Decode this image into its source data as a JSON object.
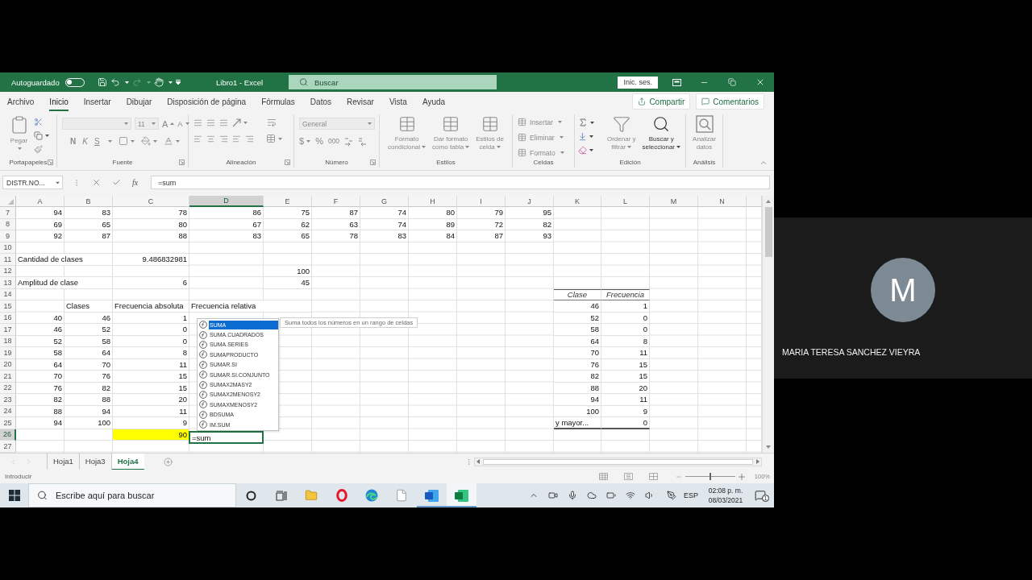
{
  "meeting": {
    "initial": "M",
    "name": "MARIA TERESA SANCHEZ VIEYRA"
  },
  "window": {
    "autosave_label": "Autoguardado",
    "autosave_on": false,
    "title": "Libro1 - Excel",
    "search_placeholder": "Buscar",
    "sign_in": "Inic. ses."
  },
  "ribbon_tabs": [
    {
      "label": "Archivo",
      "selected": false
    },
    {
      "label": "Inicio",
      "selected": true
    },
    {
      "label": "Insertar",
      "selected": false
    },
    {
      "label": "Dibujar",
      "selected": false
    },
    {
      "label": "Disposición de página",
      "selected": false
    },
    {
      "label": "Fórmulas",
      "selected": false
    },
    {
      "label": "Datos",
      "selected": false
    },
    {
      "label": "Revisar",
      "selected": false
    },
    {
      "label": "Vista",
      "selected": false
    },
    {
      "label": "Ayuda",
      "selected": false
    }
  ],
  "ribbon_actions": [
    "Compartir",
    "Comentarios"
  ],
  "ribbon": {
    "groups": [
      {
        "kind": "clipboard",
        "label": "Portapapeles",
        "launcher": true,
        "paste": "Pegar",
        "disabled": true
      },
      {
        "kind": "font",
        "label": "Fuente",
        "launcher": true,
        "size": "11",
        "size_buttons": [
          "A",
          "A"
        ],
        "styles": [
          "N",
          "K",
          "S"
        ],
        "disabled": true
      },
      {
        "kind": "alignment",
        "label": "Alineación",
        "launcher": true,
        "disabled": true
      },
      {
        "kind": "number",
        "label": "Número",
        "launcher": true,
        "format": "General",
        "symbols": [
          "$",
          "%",
          "000"
        ],
        "disabled": true
      },
      {
        "kind": "styles",
        "label": "Estilos",
        "launcher": false,
        "buttons": [
          {
            "lines": [
              "Formato",
              "condicional"
            ],
            "menu": true,
            "disabled": true
          },
          {
            "lines": [
              "Dar formato",
              "como tabla"
            ],
            "menu": true,
            "disabled": true
          },
          {
            "lines": [
              "Estilos de",
              "celda"
            ],
            "menu": true,
            "disabled": true
          }
        ]
      },
      {
        "kind": "cells",
        "label": "Celdas",
        "launcher": false,
        "buttons": [
          {
            "label": "Insertar",
            "disabled": true
          },
          {
            "label": "Eliminar",
            "disabled": true
          },
          {
            "label": "Formato",
            "disabled": true
          }
        ]
      },
      {
        "kind": "editing",
        "label": "Edición",
        "launcher": false,
        "buttons": [
          {
            "lines": [
              "Ordenar y",
              "filtrar"
            ],
            "menu": true,
            "disabled": true
          },
          {
            "lines": [
              "Buscar y",
              "seleccionar"
            ],
            "menu": true,
            "disabled": false
          }
        ]
      },
      {
        "kind": "analysis",
        "label": "Análisis",
        "launcher": false,
        "buttons": [
          {
            "lines": [
              "Analizar",
              "datos"
            ],
            "menu": false,
            "disabled": true
          }
        ]
      }
    ]
  },
  "formula_bar": {
    "name_box": "DISTR.NO...",
    "insert_function": "fx",
    "formula": "=sum"
  },
  "sheet": {
    "columns": [
      {
        "label": "A",
        "selected": false
      },
      {
        "label": "B",
        "selected": false
      },
      {
        "label": "C",
        "selected": false
      },
      {
        "label": "D",
        "selected": true
      },
      {
        "label": "E",
        "selected": false
      },
      {
        "label": "F",
        "selected": false
      },
      {
        "label": "G",
        "selected": false
      },
      {
        "label": "H",
        "selected": false
      },
      {
        "label": "I",
        "selected": false
      },
      {
        "label": "J",
        "selected": false
      },
      {
        "label": "K",
        "selected": false
      },
      {
        "label": "L",
        "selected": false
      },
      {
        "label": "M",
        "selected": false
      },
      {
        "label": "N",
        "selected": false
      }
    ],
    "rows": [
      {
        "number": "7",
        "selected": false,
        "cells": [
          {
            "kind": "number",
            "value": "94"
          },
          {
            "kind": "number",
            "value": "83"
          },
          {
            "kind": "number",
            "value": "78"
          },
          {
            "kind": "number",
            "value": "86"
          },
          {
            "kind": "number",
            "value": "75"
          },
          {
            "kind": "number",
            "value": "87"
          },
          {
            "kind": "number",
            "value": "74"
          },
          {
            "kind": "number",
            "value": "80"
          },
          {
            "kind": "number",
            "value": "79"
          },
          {
            "kind": "number",
            "value": "95"
          }
        ]
      },
      {
        "number": "8",
        "selected": false,
        "cells": [
          {
            "kind": "number",
            "value": "69"
          },
          {
            "kind": "number",
            "value": "65"
          },
          {
            "kind": "number",
            "value": "80"
          },
          {
            "kind": "number",
            "value": "67"
          },
          {
            "kind": "number",
            "value": "62"
          },
          {
            "kind": "number",
            "value": "63"
          },
          {
            "kind": "number",
            "value": "74"
          },
          {
            "kind": "number",
            "value": "89"
          },
          {
            "kind": "number",
            "value": "72"
          },
          {
            "kind": "number",
            "value": "82"
          }
        ]
      },
      {
        "number": "9",
        "selected": false,
        "cells": [
          {
            "kind": "number",
            "value": "92"
          },
          {
            "kind": "number",
            "value": "87"
          },
          {
            "kind": "number",
            "value": "88"
          },
          {
            "kind": "number",
            "value": "83"
          },
          {
            "kind": "number",
            "value": "65"
          },
          {
            "kind": "number",
            "value": "78"
          },
          {
            "kind": "number",
            "value": "83"
          },
          {
            "kind": "number",
            "value": "84"
          },
          {
            "kind": "number",
            "value": "87"
          },
          {
            "kind": "number",
            "value": "93"
          }
        ]
      },
      {
        "number": "10",
        "selected": false
      },
      {
        "number": "11",
        "selected": false,
        "cells": [
          {
            "kind": "label",
            "value": "Cantidad de clases"
          },
          null,
          {
            "kind": "number",
            "value": "9.486832981"
          }
        ]
      },
      {
        "number": "12",
        "selected": false,
        "cells": [
          null,
          null,
          null,
          null,
          {
            "kind": "number",
            "value": "100"
          }
        ]
      },
      {
        "number": "13",
        "selected": false,
        "cells": [
          {
            "kind": "label",
            "value": "Amplitud de clase"
          },
          null,
          {
            "kind": "number",
            "value": "6"
          },
          null,
          {
            "kind": "number",
            "value": "45"
          }
        ]
      },
      {
        "number": "14",
        "selected": false
      },
      {
        "number": "15",
        "selected": false,
        "cells": [
          null,
          {
            "kind": "label",
            "value": "Clases"
          },
          {
            "kind": "label",
            "value": "Frecuencia absoluta"
          },
          {
            "kind": "label",
            "value": "Frecuencia relativa"
          }
        ]
      },
      {
        "number": "16",
        "selected": false,
        "cells": [
          {
            "kind": "number",
            "value": "40"
          },
          {
            "kind": "number",
            "value": "46"
          },
          {
            "kind": "number",
            "value": "1"
          }
        ]
      },
      {
        "number": "17",
        "selected": false,
        "cells": [
          {
            "kind": "number",
            "value": "46"
          },
          {
            "kind": "number",
            "value": "52"
          },
          {
            "kind": "number",
            "value": "0"
          }
        ]
      },
      {
        "number": "18",
        "selected": false,
        "cells": [
          {
            "kind": "number",
            "value": "52"
          },
          {
            "kind": "number",
            "value": "58"
          },
          {
            "kind": "number",
            "value": "0"
          }
        ]
      },
      {
        "number": "19",
        "selected": false,
        "cells": [
          {
            "kind": "number",
            "value": "58"
          },
          {
            "kind": "number",
            "value": "64"
          },
          {
            "kind": "number",
            "value": "8"
          }
        ]
      },
      {
        "number": "20",
        "selected": false,
        "cells": [
          {
            "kind": "number",
            "value": "64"
          },
          {
            "kind": "number",
            "value": "70"
          },
          {
            "kind": "number",
            "value": "11"
          }
        ]
      },
      {
        "number": "21",
        "selected": false,
        "cells": [
          {
            "kind": "number",
            "value": "70"
          },
          {
            "kind": "number",
            "value": "76"
          },
          {
            "kind": "number",
            "value": "15"
          }
        ]
      },
      {
        "number": "22",
        "selected": false,
        "cells": [
          {
            "kind": "number",
            "value": "76"
          },
          {
            "kind": "number",
            "value": "82"
          },
          {
            "kind": "number",
            "value": "15"
          }
        ]
      },
      {
        "number": "23",
        "selected": false,
        "cells": [
          {
            "kind": "number",
            "value": "82"
          },
          {
            "kind": "number",
            "value": "88"
          },
          {
            "kind": "number",
            "value": "20"
          }
        ]
      },
      {
        "number": "24",
        "selected": false,
        "cells": [
          {
            "kind": "number",
            "value": "88"
          },
          {
            "kind": "number",
            "value": "94"
          },
          {
            "kind": "number",
            "value": "11"
          }
        ]
      },
      {
        "number": "25",
        "selected": false,
        "cells": [
          {
            "kind": "number",
            "value": "94"
          },
          {
            "kind": "number",
            "value": "100"
          },
          {
            "kind": "number",
            "value": "9"
          }
        ]
      },
      {
        "number": "26",
        "selected": true,
        "cells": [
          null,
          null,
          {
            "kind": "number",
            "value": "90",
            "color": "#ffff00"
          },
          {
            "kind": "input",
            "value": "=sum"
          }
        ]
      },
      {
        "number": "27",
        "selected": false
      }
    ]
  },
  "frequency_table": {
    "headers": [
      "Clase",
      "Frecuencia"
    ],
    "rows": [
      {
        "kind": "bin",
        "class": "46",
        "frequency": "1"
      },
      {
        "kind": "bin",
        "class": "52",
        "frequency": "0"
      },
      {
        "kind": "bin",
        "class": "58",
        "frequency": "0"
      },
      {
        "kind": "bin",
        "class": "64",
        "frequency": "8"
      },
      {
        "kind": "bin",
        "class": "70",
        "frequency": "11"
      },
      {
        "kind": "bin",
        "class": "76",
        "frequency": "15"
      },
      {
        "kind": "bin",
        "class": "82",
        "frequency": "15"
      },
      {
        "kind": "bin",
        "class": "88",
        "frequency": "20"
      },
      {
        "kind": "bin",
        "class": "94",
        "frequency": "11"
      },
      {
        "kind": "bin",
        "class": "100",
        "frequency": "9"
      },
      {
        "kind": "rest",
        "class": "y mayor...",
        "frequency": "0"
      }
    ]
  },
  "autocomplete": {
    "items": [
      {
        "label": "SUMA",
        "selected": true
      },
      {
        "label": "SUMA.CUADRADOS",
        "selected": false
      },
      {
        "label": "SUMA.SERIES",
        "selected": false
      },
      {
        "label": "SUMAPRODUCTO",
        "selected": false
      },
      {
        "label": "SUMAR.SI",
        "selected": false
      },
      {
        "label": "SUMAR.SI.CONJUNTO",
        "selected": false
      },
      {
        "label": "SUMAX2MASY2",
        "selected": false
      },
      {
        "label": "SUMAX2MENOSY2",
        "selected": false
      },
      {
        "label": "SUMAXMENOSY2",
        "selected": false
      },
      {
        "label": "BDSUMA",
        "selected": false
      },
      {
        "label": "IM.SUM",
        "selected": false
      }
    ],
    "tooltip": "Suma todos los números en un rango de celdas"
  },
  "sheet_tabs": [
    {
      "label": "Hoja1",
      "selected": false
    },
    {
      "label": "Hoja3",
      "selected": false
    },
    {
      "label": "Hoja4",
      "selected": true
    }
  ],
  "status_bar": {
    "mode": "Introducir",
    "zoom_slider": {
      "level": 0.5
    },
    "zoom": "100%"
  },
  "taskbar": {
    "search_placeholder": "Escribe aquí para buscar",
    "apps": [
      {
        "kind": "ring",
        "open": false,
        "selected": false
      },
      {
        "kind": "taskview",
        "open": false,
        "selected": false
      },
      {
        "kind": "folder",
        "open": false,
        "selected": false
      },
      {
        "kind": "redring",
        "open": false,
        "selected": false
      },
      {
        "kind": "swirl",
        "open": false,
        "selected": false
      },
      {
        "kind": "page",
        "open": false,
        "selected": false
      },
      {
        "kind": "document",
        "open": true,
        "selected": false
      },
      {
        "kind": "spreadsheet",
        "open": true,
        "selected": true
      }
    ],
    "language": "ESP",
    "time": "02:08 p. m.",
    "date": "08/03/2021",
    "notifications": "1"
  }
}
